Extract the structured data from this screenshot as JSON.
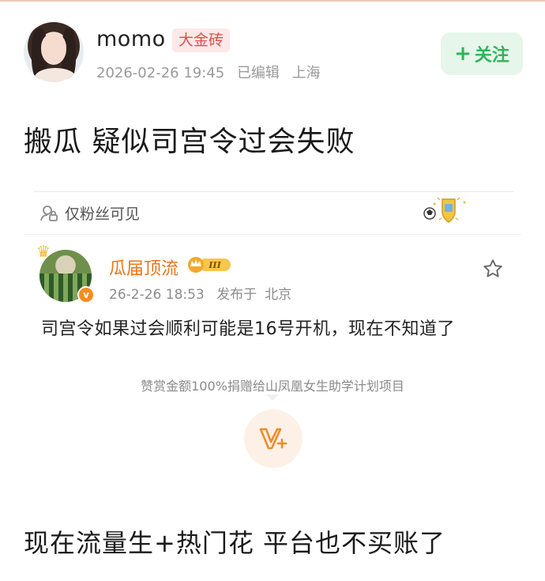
{
  "post": {
    "author": {
      "name": "momo",
      "badge": "大金砖",
      "timestamp": "2026-02-26 19:45",
      "edited": "已编辑",
      "location": "上海"
    },
    "follow_label": "关注",
    "title": "搬瓜 疑似司宫令过会失败",
    "body_text": "现在流量生+热门花 平台也不买账了"
  },
  "quoted": {
    "visibility": "仅粉丝可见",
    "author": {
      "name": "瓜届顶流",
      "vip_level": "III",
      "verified_mark": "v"
    },
    "timestamp": "26-2-26 18:53",
    "published_prefix": "发布于",
    "location": "北京",
    "text": "司宫令如果过会顺利可能是16号开机，现在不知道了",
    "reward_note": "赞赏金额100%捐赠给山凤凰女生助学计划项目"
  },
  "icons": {
    "follow": "plus-icon",
    "visibility": "lock-people-icon",
    "medal": "medal-badge-icon",
    "favorite": "star-icon",
    "reward": "v-plus-reward-icon"
  },
  "colors": {
    "follow_green": "#2fb45a",
    "badge_red": "#e0514a",
    "quoted_name_orange": "#e8751a",
    "reward_bg": "#fdf1e7"
  }
}
